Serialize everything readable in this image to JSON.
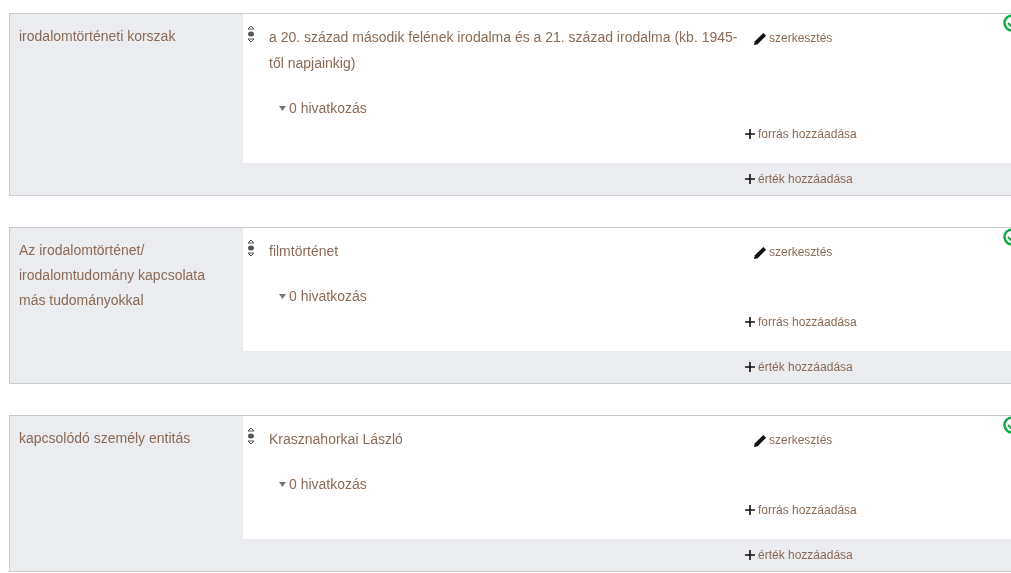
{
  "statements": [
    {
      "property": "irodalomtörténeti korszak",
      "value": "a 20. század második felének irodalma és a 21. század irodalma (kb. 1945-től napjainkig)",
      "references": "0 hivatkozás",
      "edit": "szerkesztés",
      "add_reference": "forrás hozzáadása",
      "add_value": "érték hozzáadása"
    },
    {
      "property": "Az irodalomtörténet/ irodalomtudomány kapcsolata más tudományokkal",
      "value": "filmtörténet",
      "references": "0 hivatkozás",
      "edit": "szerkesztés",
      "add_reference": "forrás hozzáadása",
      "add_value": "érték hozzáadása"
    },
    {
      "property": "kapcsolódó személy entitás",
      "value": "Krasznahorkai László",
      "references": "0 hivatkozás",
      "edit": "szerkesztés",
      "add_reference": "forrás hozzáadása",
      "add_value": "érték hozzáadása"
    }
  ]
}
